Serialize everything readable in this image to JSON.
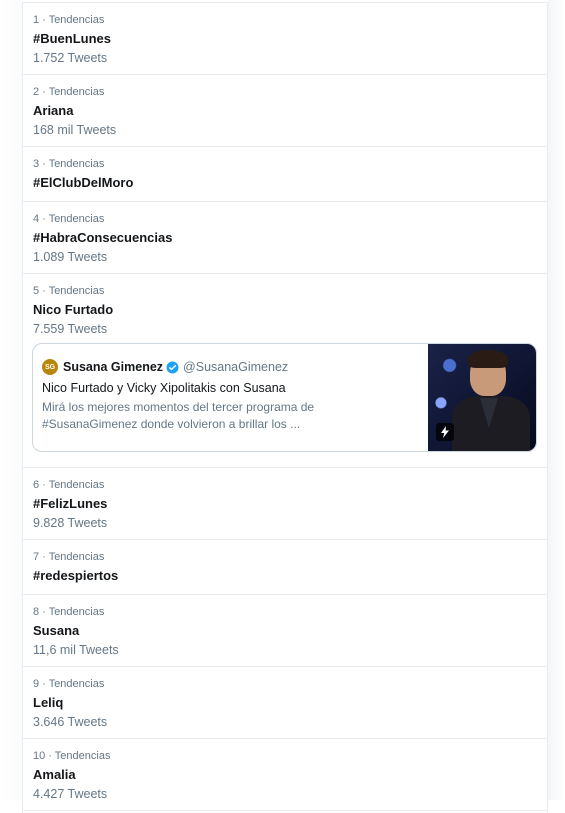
{
  "trends": [
    {
      "meta": "1 · Tendencias",
      "name": "#BuenLunes",
      "count": "1.752 Tweets"
    },
    {
      "meta": "2 · Tendencias",
      "name": "Ariana",
      "count": "168 mil Tweets"
    },
    {
      "meta": "3 · Tendencias",
      "name": "#ElClubDelMoro",
      "count": null
    },
    {
      "meta": "4 · Tendencias",
      "name": "#HabraConsecuencias",
      "count": "1.089 Tweets"
    },
    {
      "meta": "5 · Tendencias",
      "name": "Nico Furtado",
      "count": "7.559 Tweets"
    },
    {
      "meta": "6 · Tendencias",
      "name": "#FelizLunes",
      "count": "9.828 Tweets"
    },
    {
      "meta": "7 · Tendencias",
      "name": "#redespiertos",
      "count": null
    },
    {
      "meta": "8 · Tendencias",
      "name": "Susana",
      "count": "11,6 mil Tweets"
    },
    {
      "meta": "9 · Tendencias",
      "name": "Leliq",
      "count": "3.646 Tweets"
    },
    {
      "meta": "10 · Tendencias",
      "name": "Amalia",
      "count": "4.427 Tweets"
    }
  ],
  "card": {
    "avatar_text": "SG",
    "author": "Susana Gimenez",
    "handle": "@SusanaGimenez",
    "title": "Nico Furtado y Vicky Xipolitakis con Susana",
    "desc_line1": "Mirá los mejores momentos del tercer programa de",
    "desc_line2": "#SusanaGimenez donde volvieron a brillar los ...",
    "verified_icon": "verified-badge-icon",
    "media_icon": "flash-icon"
  },
  "colors": {
    "muted_text": "#657786",
    "primary_text": "#14171a",
    "border": "#e6ecf0",
    "verified": "#1da1f2"
  }
}
